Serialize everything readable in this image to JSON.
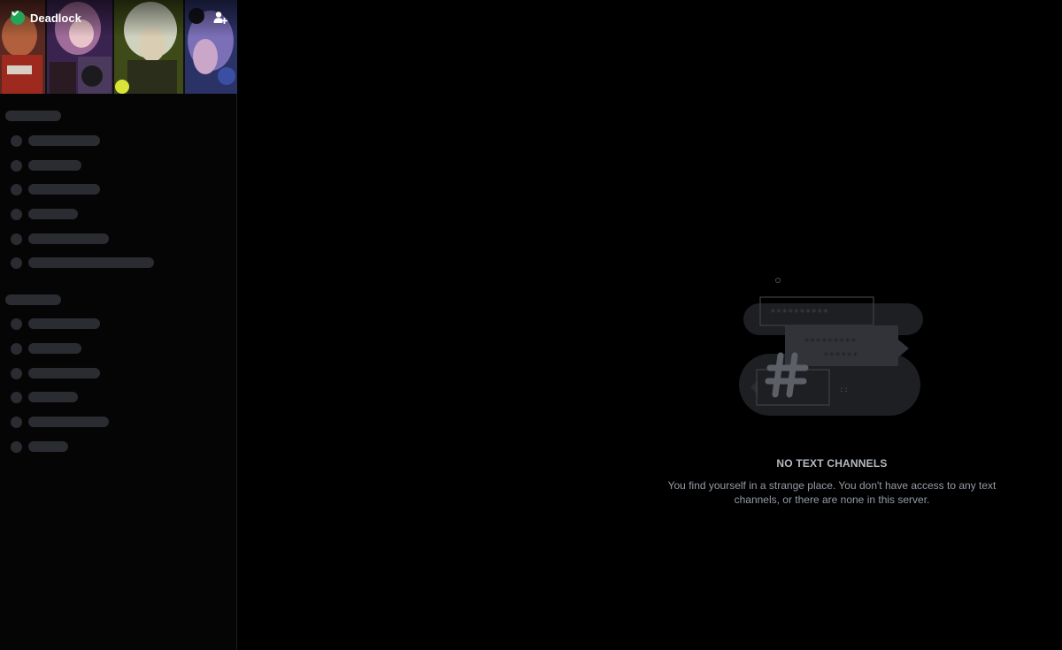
{
  "server": {
    "name": "Deadlock",
    "verified_icon": "verified-check-icon",
    "dropdown_icon": "chevron-down-icon",
    "invite_icon": "add-member-icon"
  },
  "empty_state": {
    "title": "NO TEXT CHANNELS",
    "description": "You find yourself in a strange place. You don't have access to any text channels, or there are none in this server.",
    "illustration_icon": "hashtag-icon"
  },
  "colors": {
    "background": "#000000",
    "sidebar": "#050506",
    "skeleton": "#2b2c31",
    "verified": "#23a559",
    "title_text": "#b5bac1",
    "description_text": "#949ba4"
  }
}
